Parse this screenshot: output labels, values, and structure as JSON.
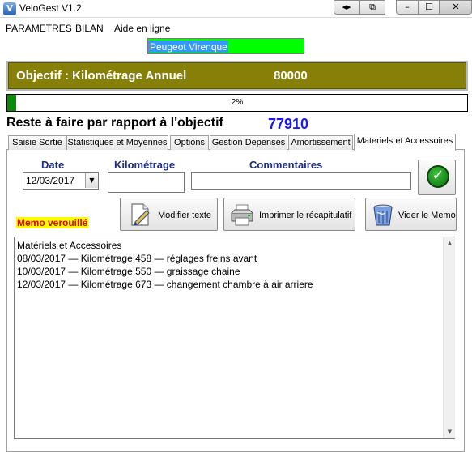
{
  "window": {
    "title": "VeloGest V1.2",
    "icon_text": "V"
  },
  "menu": [
    "PARAMETRES",
    "BILAN",
    "Aide en ligne"
  ],
  "vehicle": "Peugeot Virenque",
  "objective": {
    "label": "Objectif : Kilométrage Annuel",
    "value": "80000"
  },
  "progress": {
    "percent": 2,
    "text": "2%"
  },
  "remaining": {
    "label": "Reste à faire par rapport à l'objectif",
    "value": "77910"
  },
  "tabs": [
    "Saisie Sortie",
    "Statistiques et Moyennes",
    "Options",
    "Gestion Depenses",
    "Amortissement",
    "Materiels et Accessoires"
  ],
  "active_tab": "Materiels et Accessoires",
  "form": {
    "date_label": "Date",
    "date_value": "12/03/2017",
    "km_label": "Kilométrage",
    "km_value": "",
    "comment_label": "Commentaires",
    "comment_value": ""
  },
  "buttons": {
    "edit_text": "Modifier texte",
    "print": "Imprimer le récapitulatif",
    "clear_memo": "Vider le Memo"
  },
  "memo_status": "Memo verouillé",
  "memo_lines": [
    "Matériels et Accessoires",
    "08/03/2017 — Kilométrage 458 — réglages freins avant",
    "10/03/2017 — Kilométrage 550 — graissage chaine",
    "12/03/2017 — Kilométrage 673 — changement chambre à air arriere"
  ],
  "colors": {
    "objective_banner": "#868008",
    "vehicle_highlight": "#00ff00",
    "progress_fill": "#0a8a0a",
    "remaining_value": "#1a1aee",
    "field_label": "#1c2e88",
    "memo_locked_bg": "#ffff00",
    "memo_locked_text": "#e00000"
  }
}
